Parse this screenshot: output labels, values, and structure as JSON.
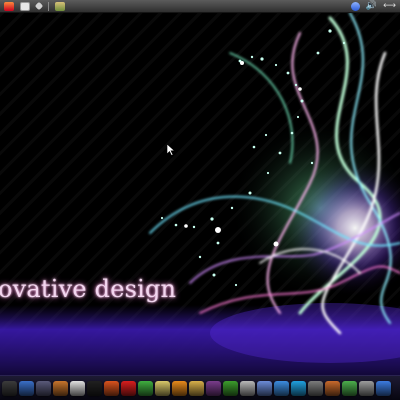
{
  "top_panel": {
    "left_icons": [
      "menu-icon",
      "printer-icon",
      "diamond-icon",
      "pictures-icon"
    ],
    "right_icons": [
      "user-icon",
      "volume-icon",
      "network-icon"
    ],
    "volume_glyph": "🔊",
    "network_glyph": "⟷"
  },
  "desktop": {
    "tagline": "ovative design"
  },
  "dock": {
    "icons": [
      {
        "name": "terminal-icon",
        "color": "#3b3b3b"
      },
      {
        "name": "monitor-icon",
        "color": "#3a6fc8"
      },
      {
        "name": "window-manager-icon",
        "color": "#5a5a7a"
      },
      {
        "name": "archive-icon",
        "color": "#c8752c"
      },
      {
        "name": "printer-icon",
        "color": "#e0e0e0"
      },
      {
        "name": "terminal-icon",
        "color": "#202020"
      },
      {
        "name": "browser-icon",
        "color": "#d9531e"
      },
      {
        "name": "opera-icon",
        "color": "#d81e1e"
      },
      {
        "name": "calculator-icon",
        "color": "#3fae3f"
      },
      {
        "name": "photo-editor-icon",
        "color": "#d8c86a"
      },
      {
        "name": "blender-icon",
        "color": "#e78a1c"
      },
      {
        "name": "paint-icon",
        "color": "#d8b04a"
      },
      {
        "name": "image-viewer-icon",
        "color": "#7a3c8c"
      },
      {
        "name": "plant-icon",
        "color": "#3c9c2c"
      },
      {
        "name": "notes-icon",
        "color": "#b8b8b8"
      },
      {
        "name": "media-player-icon",
        "color": "#6c8cd8"
      },
      {
        "name": "chat-icon",
        "color": "#3c8ce0"
      },
      {
        "name": "skype-icon",
        "color": "#20a0e0"
      },
      {
        "name": "transfer-icon",
        "color": "#7c7c7c"
      },
      {
        "name": "guitar-icon",
        "color": "#c86a2c"
      },
      {
        "name": "equalizer-icon",
        "color": "#4cae4c"
      },
      {
        "name": "trash-icon",
        "color": "#9c9c9c"
      },
      {
        "name": "play-icon",
        "color": "#3c7ce0"
      }
    ]
  }
}
